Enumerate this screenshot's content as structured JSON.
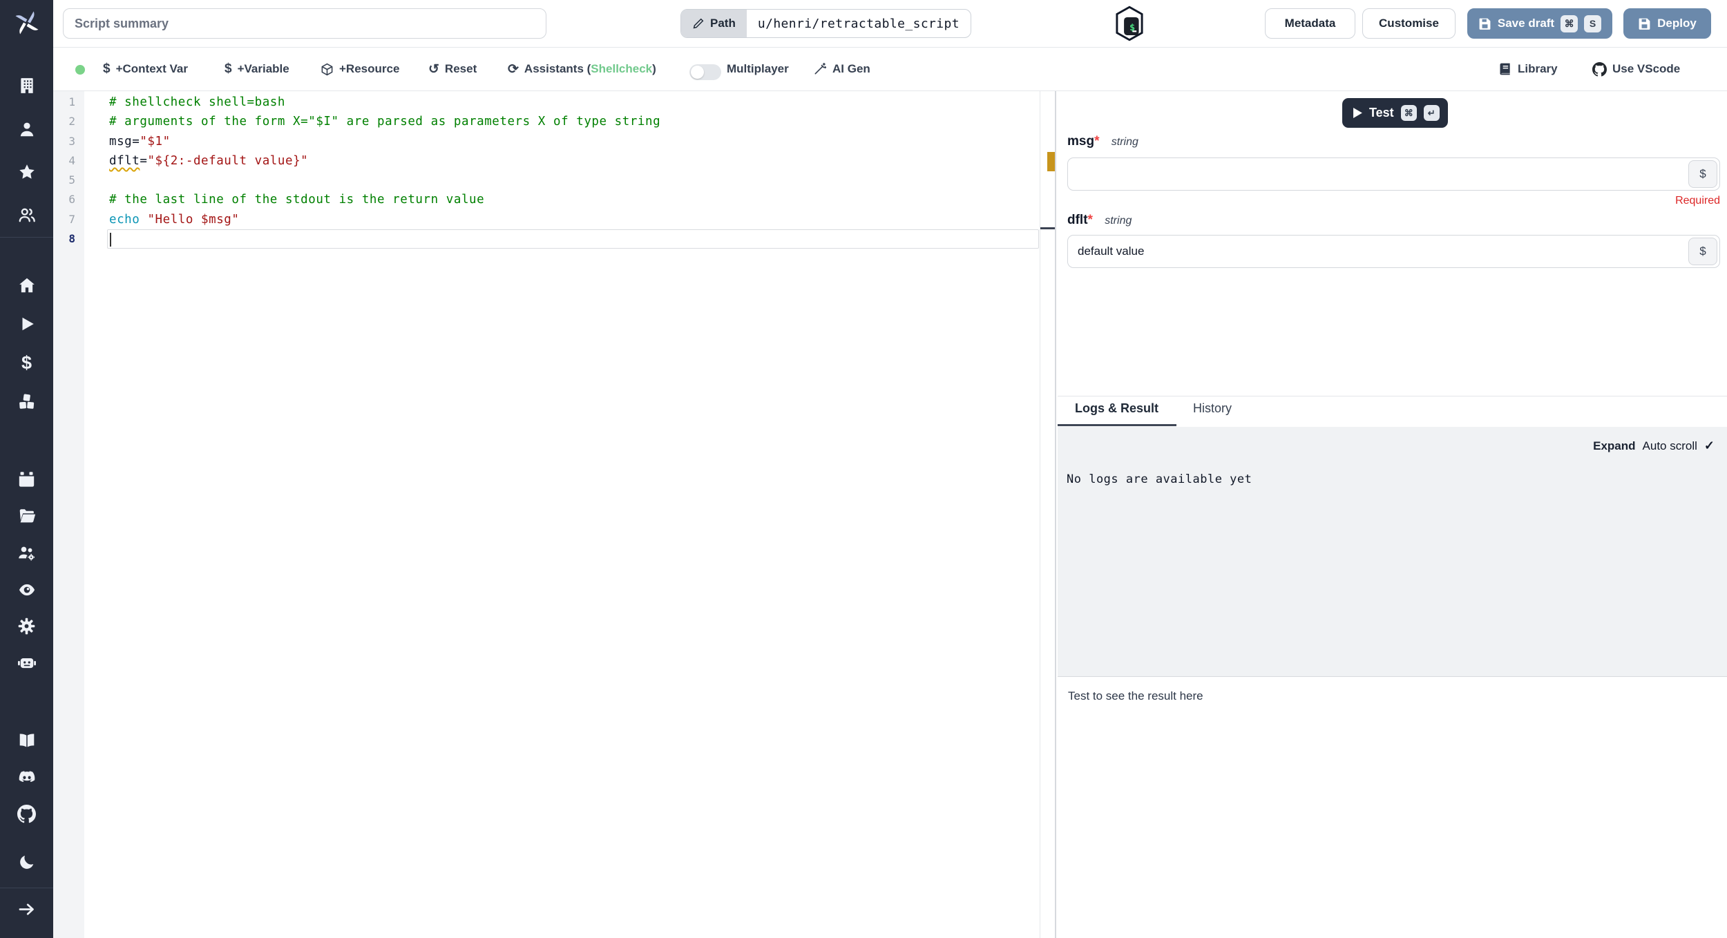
{
  "colors": {
    "accent_blue": "#6b89ab",
    "sidebar_bg": "#262c3a",
    "test_button_bg": "#252d3d",
    "status_dot_green": "#7bd389",
    "shellcheck_green": "#71c98c",
    "required_red": "#dc2626",
    "code_comment": "#008000",
    "code_string": "#a31515",
    "code_keyword": "#0b95b5",
    "warning_gold": "#d9a40b"
  },
  "topbar": {
    "summary_placeholder": "Script summary",
    "path_label": "Path",
    "path_value": "u/henri/retractable_script",
    "language_icon": "bash-icon",
    "metadata_label": "Metadata",
    "customise_label": "Customise",
    "save_draft_label": "Save draft",
    "save_draft_kbd1": "⌘",
    "save_draft_kbd2": "S",
    "deploy_label": "Deploy"
  },
  "toolbar": {
    "context_var_label": "+Context Var",
    "variable_label": "+Variable",
    "resource_label": "+Resource",
    "reset_label": "Reset",
    "assistants_prefix": "Assistants (",
    "assistants_lint": "Shellcheck",
    "assistants_suffix": ")",
    "multiplayer_label": "Multiplayer",
    "ai_gen_label": "AI Gen",
    "library_label": "Library",
    "use_vscode_label": "Use VScode",
    "dollar_icon": "$",
    "reset_icon": "↺",
    "assistants_icon": "⟳"
  },
  "editor": {
    "lines": [
      {
        "n": "1",
        "tokens": [
          {
            "t": "# shellcheck shell=bash",
            "c": "cmt"
          }
        ]
      },
      {
        "n": "2",
        "tokens": [
          {
            "t": "# arguments of the form X=\"$I\" are parsed as parameters X of type string",
            "c": "cmt"
          }
        ]
      },
      {
        "n": "3",
        "tokens": [
          {
            "t": "msg=",
            "c": "plain"
          },
          {
            "t": "\"$1\"",
            "c": "str"
          }
        ]
      },
      {
        "n": "4",
        "tokens": [
          {
            "t": "dflt",
            "c": "plain warn"
          },
          {
            "t": "=",
            "c": "plain"
          },
          {
            "t": "\"${2:-default value}\"",
            "c": "str"
          }
        ]
      },
      {
        "n": "5",
        "tokens": []
      },
      {
        "n": "6",
        "tokens": [
          {
            "t": "# the last line of the stdout is the return value",
            "c": "cmt"
          }
        ]
      },
      {
        "n": "7",
        "tokens": [
          {
            "t": "echo",
            "c": "kw"
          },
          {
            "t": " ",
            "c": "plain"
          },
          {
            "t": "\"Hello $msg\"",
            "c": "str"
          }
        ]
      },
      {
        "n": "8",
        "tokens": [],
        "active": true
      }
    ]
  },
  "right_panel": {
    "test_label": "Test",
    "test_kbd1": "⌘",
    "test_kbd2": "↵",
    "fields": [
      {
        "name": "msg",
        "type": "string",
        "value": "",
        "required_note": "Required",
        "var_button": "$"
      },
      {
        "name": "dflt",
        "type": "string",
        "value": "default value",
        "var_button": "$"
      }
    ],
    "tabs": {
      "logs": "Logs & Result",
      "history": "History"
    },
    "logs": {
      "expand_label": "Expand",
      "autoscroll_label": "Auto scroll",
      "autoscroll_check": "✓",
      "empty_message": "No logs are available yet"
    },
    "result_placeholder": "Test to see the result here"
  },
  "sidebar": {
    "logo": "windmill-logo",
    "top_icons": [
      "building",
      "user",
      "star",
      "users"
    ],
    "main_icons": [
      "home",
      "runs",
      "variables",
      "resources"
    ],
    "ops_icons": [
      "schedules",
      "folders",
      "groups",
      "audit-logs",
      "settings",
      "workers"
    ],
    "link_icons": [
      "docs",
      "discord",
      "github"
    ],
    "footer_icons": [
      "dark-mode",
      "collapse"
    ]
  }
}
